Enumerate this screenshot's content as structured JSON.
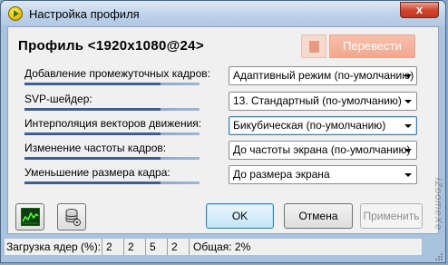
{
  "window": {
    "title": "Настройка профиля",
    "close_label": "x"
  },
  "header": {
    "profile_title": "Профиль <1920x1080@24>",
    "translate_label": "Перевести"
  },
  "settings": [
    {
      "label": "Добавление промежуточных кадров:",
      "value": "Адаптивный режим (по-умолчанию)"
    },
    {
      "label": "SVP-шейдер:",
      "value": "13. Стандартный (по-умолчанию)"
    },
    {
      "label": "Интерполяция векторов движения:",
      "value": "Бикубическая (по-умолчанию)"
    },
    {
      "label": "Изменение частоты кадров:",
      "value": "До частоты экрана (по-умолчанию)"
    },
    {
      "label": "Уменьшение размера кадра:",
      "value": "До размера экрана"
    }
  ],
  "buttons": {
    "ok": "OK",
    "cancel": "Отмена",
    "apply": "Применить"
  },
  "statusbar": {
    "load_label": "Загрузка ядер (%):",
    "cores": [
      "2",
      "2",
      "5",
      "2"
    ],
    "total": "Общая: 2%"
  },
  "watermark": "iZoomeXe",
  "colors": {
    "accent": "#3c7fb1",
    "translate_button": "#f2a78e",
    "window_frame": "#b4cbe3"
  },
  "icons": [
    "app-icon",
    "close-icon",
    "book-icon",
    "graph-icon",
    "database-settings-icon",
    "chevron-down-icon",
    "resize-grip-icon"
  ]
}
